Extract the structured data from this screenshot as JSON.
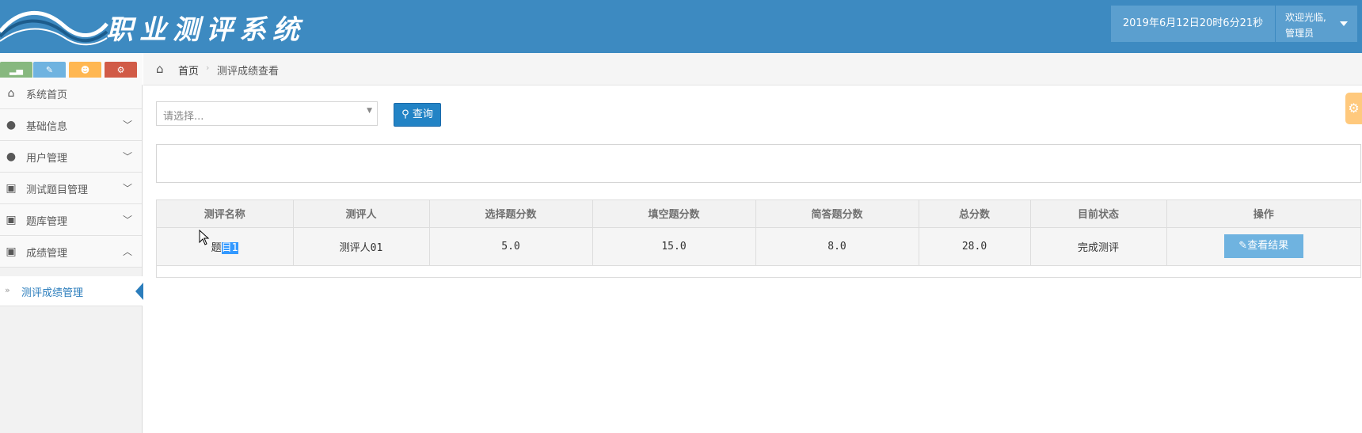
{
  "header": {
    "app_title": "职业测评系统",
    "datetime": "2019年6月12日20时6分21秒",
    "user_greeting": "欢迎光临,",
    "user_role": "管理员",
    "brand_color": "#3d8ac1"
  },
  "sidebar": {
    "shortcuts": [
      "signal-icon",
      "pencil-icon",
      "users-icon",
      "cogs-icon"
    ],
    "items": [
      {
        "label": "系统首页",
        "icon": "home-icon"
      },
      {
        "label": "基础信息",
        "icon": "user-icon"
      },
      {
        "label": "用户管理",
        "icon": "user-icon"
      },
      {
        "label": "测试题目管理",
        "icon": "picture-icon"
      },
      {
        "label": "题库管理",
        "icon": "picture-icon"
      },
      {
        "label": "成绩管理",
        "icon": "picture-icon"
      }
    ],
    "active_subitem": "测评成绩管理"
  },
  "breadcrumb": {
    "home": "首页",
    "current": "测评成绩查看"
  },
  "search": {
    "placeholder": "请选择...",
    "button_label": "查询"
  },
  "table": {
    "headers": [
      "测评名称",
      "测评人",
      "选择题分数",
      "填空题分数",
      "简答题分数",
      "总分数",
      "目前状态",
      "操作"
    ],
    "rows": [
      {
        "name_part1": "题",
        "name_part2": "目1",
        "person": "测评人01",
        "choice": "5.0",
        "fill": "15.0",
        "short": "8.0",
        "total": "28.0",
        "status": "完成测评",
        "action": "查看结果"
      }
    ]
  }
}
